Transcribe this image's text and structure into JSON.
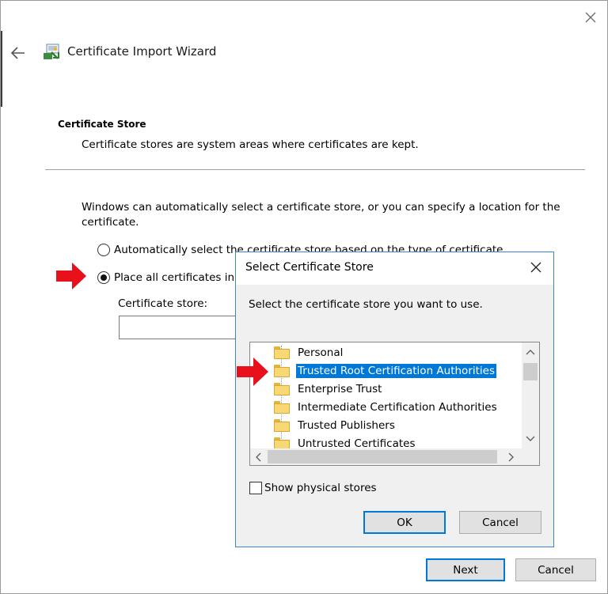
{
  "wizard": {
    "title": "Certificate Import Wizard",
    "section_title": "Certificate Store",
    "section_desc": "Certificate stores are system areas where certificates are kept.",
    "intro": "Windows can automatically select a certificate store, or you can specify a location for the certificate.",
    "options": [
      {
        "label": "Automatically select the certificate store based on the type of certificate",
        "checked": false
      },
      {
        "label": "Place all certificates in the following store",
        "checked": true
      }
    ],
    "store_label": "Certificate store:",
    "store_value": "",
    "next_label": "Next",
    "cancel_label": "Cancel"
  },
  "dialog": {
    "title": "Select Certificate Store",
    "prompt": "Select the certificate store you want to use.",
    "stores": [
      {
        "label": "Personal",
        "selected": false
      },
      {
        "label": "Trusted Root Certification Authorities",
        "selected": true
      },
      {
        "label": "Enterprise Trust",
        "selected": false
      },
      {
        "label": "Intermediate Certification Authorities",
        "selected": false
      },
      {
        "label": "Trusted Publishers",
        "selected": false
      },
      {
        "label": "Untrusted Certificates",
        "selected": false
      }
    ],
    "show_physical_label": "Show physical stores",
    "show_physical_checked": false,
    "ok_label": "OK",
    "cancel_label": "Cancel"
  },
  "colors": {
    "accent": "#0078d7",
    "annotation_arrow": "#e8101a",
    "folder": "#f8d775"
  },
  "icons": {
    "close": "close-icon",
    "back": "back-arrow-icon",
    "wizard": "certificate-wizard-icon",
    "folder": "folder-icon",
    "annotation": "red-pointer-arrow-icon"
  }
}
